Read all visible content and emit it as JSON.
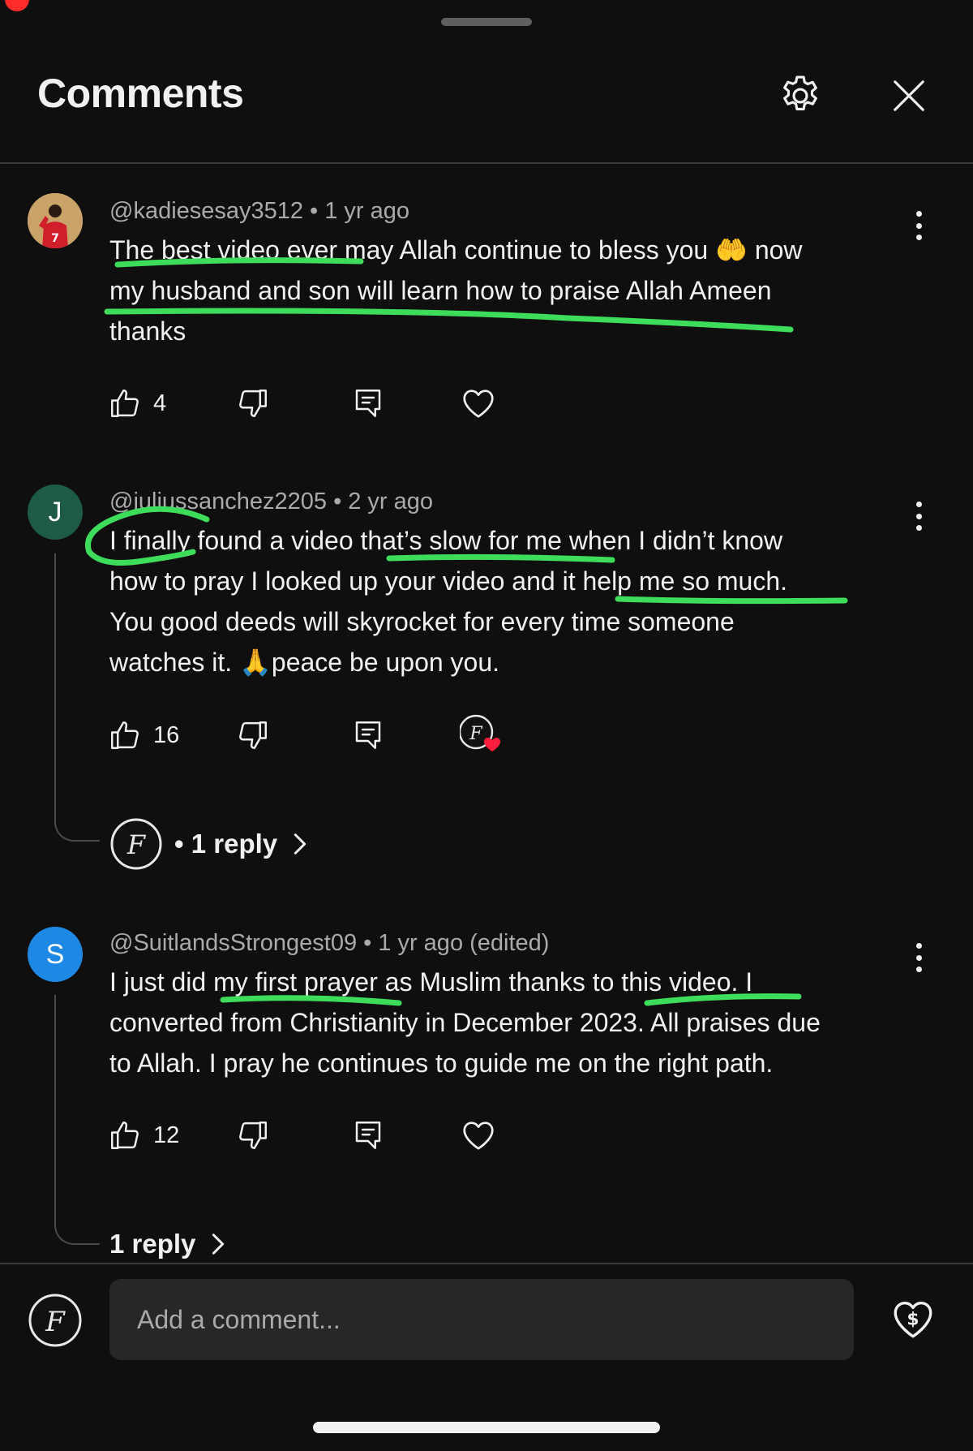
{
  "header": {
    "title": "Comments",
    "settings_icon": "gear-icon",
    "close_icon": "close-icon"
  },
  "comments": [
    {
      "avatar_letter": "",
      "avatar_color": "#c9a36a",
      "meta": {
        "handle": "@kadiesesay3512",
        "age": "1 yr ago"
      },
      "lines": [
        "The best video ever may Allah continue to bless you 🤲 now",
        "my husband and son will learn how to praise Allah Ameen",
        "thanks"
      ],
      "likes": "4",
      "heart_state": "outline"
    },
    {
      "avatar_letter": "J",
      "avatar_color": "#1d5a48",
      "meta": {
        "handle": "@juliussanchez2205",
        "age": "2 yr ago"
      },
      "lines": [
        "I finally found a video that’s slow for me when I didn’t know",
        "how to pray I looked up your video and it help me so much.",
        "You good deeds will skyrocket for every time someone",
        "watches it. 🙏peace be upon you."
      ],
      "likes": "16",
      "heart_state": "creator-hearted",
      "reply_label": "1 reply"
    },
    {
      "avatar_letter": "S",
      "avatar_color": "#1e88e5",
      "meta": {
        "handle": "@SuitlandsStrongest09",
        "age": "1 yr ago (edited)"
      },
      "lines": [
        "I just did my first prayer as Muslim thanks to this video. I",
        "converted from Christianity in December 2023. All praises due",
        "to Allah. I pray he continues to guide me on the right path."
      ],
      "likes": "12",
      "heart_state": "outline",
      "reply_label": "1 reply"
    }
  ],
  "composer": {
    "placeholder": "Add a comment...",
    "thanks_icon": "super-thanks-icon"
  },
  "highlight_color": "#3ddc5a"
}
